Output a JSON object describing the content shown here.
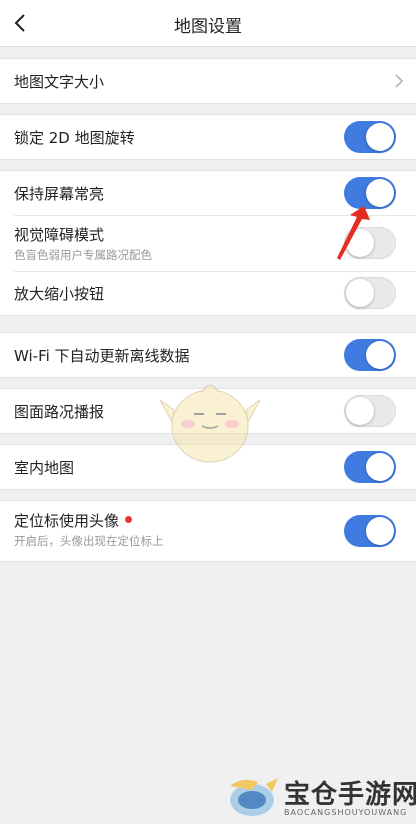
{
  "header": {
    "title": "地图设置"
  },
  "groups": [
    {
      "rows": [
        {
          "label": "地图文字大小",
          "control": "chevron"
        }
      ]
    },
    {
      "rows": [
        {
          "label": "锁定 2D 地图旋转",
          "control": "toggle",
          "on": true
        }
      ]
    },
    {
      "rows": [
        {
          "label": "保持屏幕常亮",
          "control": "toggle",
          "on": true
        },
        {
          "label": "视觉障碍模式",
          "sublabel": "色盲色弱用户专属路况配色",
          "control": "toggle",
          "on": false
        },
        {
          "label": "放大缩小按钮",
          "control": "toggle",
          "on": false
        }
      ]
    },
    {
      "rows": [
        {
          "label": "Wi-Fi 下自动更新离线数据",
          "control": "toggle",
          "on": true
        }
      ]
    },
    {
      "rows": [
        {
          "label": "图面路况播报",
          "control": "toggle",
          "on": false
        }
      ]
    },
    {
      "rows": [
        {
          "label": "室内地图",
          "control": "toggle",
          "on": true
        }
      ]
    },
    {
      "rows": [
        {
          "label": "定位标使用头像",
          "sublabel": "开启后，头像出现在定位标上",
          "control": "toggle",
          "on": true,
          "badge": "red-dot"
        }
      ]
    }
  ],
  "watermark": {
    "title": "宝仓手游网",
    "subtitle": "BAOCANGSHOUYOUWANG"
  },
  "colors": {
    "toggle_on": "#3f7be0",
    "toggle_off": "#e9e9ec",
    "background": "#f0f0f2",
    "annotation_arrow": "#e52b1f"
  },
  "icons": {
    "back": "chevron-left-icon",
    "row_chevron": "chevron-right-icon"
  }
}
